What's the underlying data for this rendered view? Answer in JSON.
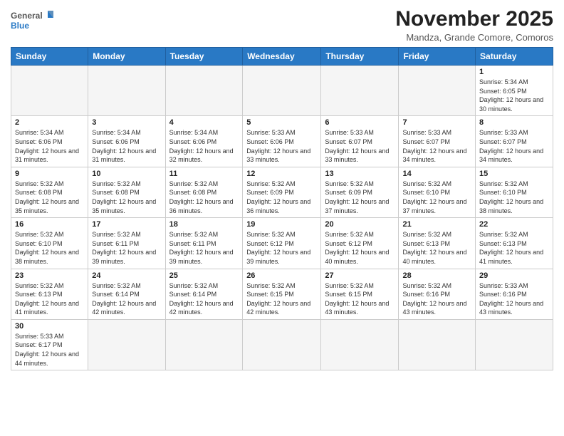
{
  "header": {
    "logo_text_normal": "General",
    "logo_text_blue": "Blue",
    "month_title": "November 2025",
    "subtitle": "Mandza, Grande Comore, Comoros"
  },
  "days_of_week": [
    "Sunday",
    "Monday",
    "Tuesday",
    "Wednesday",
    "Thursday",
    "Friday",
    "Saturday"
  ],
  "weeks": [
    [
      {
        "day": "",
        "info": ""
      },
      {
        "day": "",
        "info": ""
      },
      {
        "day": "",
        "info": ""
      },
      {
        "day": "",
        "info": ""
      },
      {
        "day": "",
        "info": ""
      },
      {
        "day": "",
        "info": ""
      },
      {
        "day": "1",
        "info": "Sunrise: 5:34 AM\nSunset: 6:05 PM\nDaylight: 12 hours and 30 minutes."
      }
    ],
    [
      {
        "day": "2",
        "info": "Sunrise: 5:34 AM\nSunset: 6:06 PM\nDaylight: 12 hours and 31 minutes."
      },
      {
        "day": "3",
        "info": "Sunrise: 5:34 AM\nSunset: 6:06 PM\nDaylight: 12 hours and 31 minutes."
      },
      {
        "day": "4",
        "info": "Sunrise: 5:34 AM\nSunset: 6:06 PM\nDaylight: 12 hours and 32 minutes."
      },
      {
        "day": "5",
        "info": "Sunrise: 5:33 AM\nSunset: 6:06 PM\nDaylight: 12 hours and 33 minutes."
      },
      {
        "day": "6",
        "info": "Sunrise: 5:33 AM\nSunset: 6:07 PM\nDaylight: 12 hours and 33 minutes."
      },
      {
        "day": "7",
        "info": "Sunrise: 5:33 AM\nSunset: 6:07 PM\nDaylight: 12 hours and 34 minutes."
      },
      {
        "day": "8",
        "info": "Sunrise: 5:33 AM\nSunset: 6:07 PM\nDaylight: 12 hours and 34 minutes."
      }
    ],
    [
      {
        "day": "9",
        "info": "Sunrise: 5:32 AM\nSunset: 6:08 PM\nDaylight: 12 hours and 35 minutes."
      },
      {
        "day": "10",
        "info": "Sunrise: 5:32 AM\nSunset: 6:08 PM\nDaylight: 12 hours and 35 minutes."
      },
      {
        "day": "11",
        "info": "Sunrise: 5:32 AM\nSunset: 6:08 PM\nDaylight: 12 hours and 36 minutes."
      },
      {
        "day": "12",
        "info": "Sunrise: 5:32 AM\nSunset: 6:09 PM\nDaylight: 12 hours and 36 minutes."
      },
      {
        "day": "13",
        "info": "Sunrise: 5:32 AM\nSunset: 6:09 PM\nDaylight: 12 hours and 37 minutes."
      },
      {
        "day": "14",
        "info": "Sunrise: 5:32 AM\nSunset: 6:10 PM\nDaylight: 12 hours and 37 minutes."
      },
      {
        "day": "15",
        "info": "Sunrise: 5:32 AM\nSunset: 6:10 PM\nDaylight: 12 hours and 38 minutes."
      }
    ],
    [
      {
        "day": "16",
        "info": "Sunrise: 5:32 AM\nSunset: 6:10 PM\nDaylight: 12 hours and 38 minutes."
      },
      {
        "day": "17",
        "info": "Sunrise: 5:32 AM\nSunset: 6:11 PM\nDaylight: 12 hours and 39 minutes."
      },
      {
        "day": "18",
        "info": "Sunrise: 5:32 AM\nSunset: 6:11 PM\nDaylight: 12 hours and 39 minutes."
      },
      {
        "day": "19",
        "info": "Sunrise: 5:32 AM\nSunset: 6:12 PM\nDaylight: 12 hours and 39 minutes."
      },
      {
        "day": "20",
        "info": "Sunrise: 5:32 AM\nSunset: 6:12 PM\nDaylight: 12 hours and 40 minutes."
      },
      {
        "day": "21",
        "info": "Sunrise: 5:32 AM\nSunset: 6:13 PM\nDaylight: 12 hours and 40 minutes."
      },
      {
        "day": "22",
        "info": "Sunrise: 5:32 AM\nSunset: 6:13 PM\nDaylight: 12 hours and 41 minutes."
      }
    ],
    [
      {
        "day": "23",
        "info": "Sunrise: 5:32 AM\nSunset: 6:13 PM\nDaylight: 12 hours and 41 minutes."
      },
      {
        "day": "24",
        "info": "Sunrise: 5:32 AM\nSunset: 6:14 PM\nDaylight: 12 hours and 42 minutes."
      },
      {
        "day": "25",
        "info": "Sunrise: 5:32 AM\nSunset: 6:14 PM\nDaylight: 12 hours and 42 minutes."
      },
      {
        "day": "26",
        "info": "Sunrise: 5:32 AM\nSunset: 6:15 PM\nDaylight: 12 hours and 42 minutes."
      },
      {
        "day": "27",
        "info": "Sunrise: 5:32 AM\nSunset: 6:15 PM\nDaylight: 12 hours and 43 minutes."
      },
      {
        "day": "28",
        "info": "Sunrise: 5:32 AM\nSunset: 6:16 PM\nDaylight: 12 hours and 43 minutes."
      },
      {
        "day": "29",
        "info": "Sunrise: 5:33 AM\nSunset: 6:16 PM\nDaylight: 12 hours and 43 minutes."
      }
    ],
    [
      {
        "day": "30",
        "info": "Sunrise: 5:33 AM\nSunset: 6:17 PM\nDaylight: 12 hours and 44 minutes."
      },
      {
        "day": "",
        "info": ""
      },
      {
        "day": "",
        "info": ""
      },
      {
        "day": "",
        "info": ""
      },
      {
        "day": "",
        "info": ""
      },
      {
        "day": "",
        "info": ""
      },
      {
        "day": "",
        "info": ""
      }
    ]
  ]
}
